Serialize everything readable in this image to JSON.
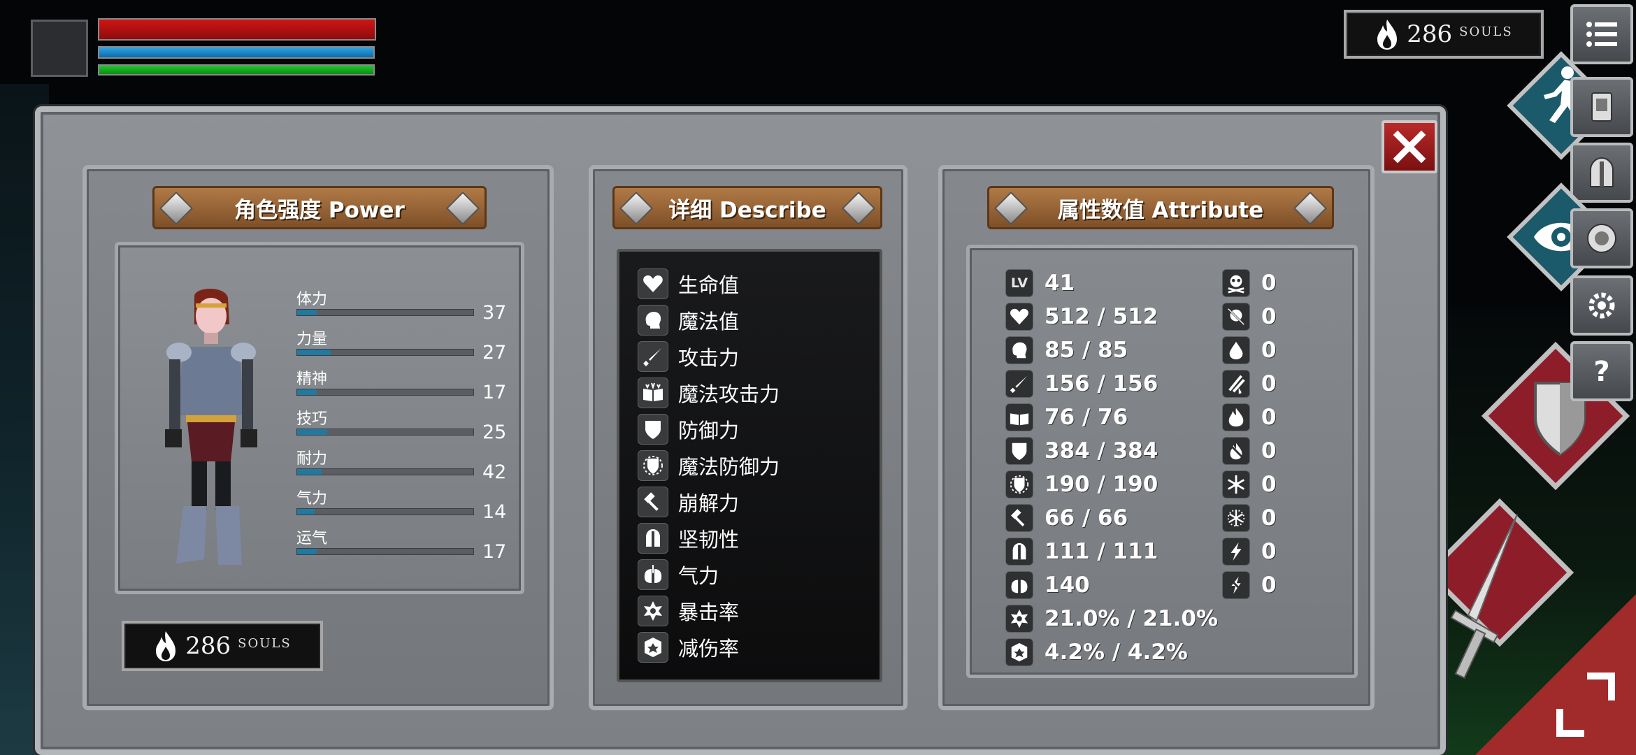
{
  "hud": {
    "souls_top": {
      "value": "286",
      "unit": "SOULS"
    },
    "hp_fill": 1.0,
    "mp_fill": 1.0,
    "stamina_fill": 1.0
  },
  "side_menu": [
    "menu-icon",
    "map-scroll-icon",
    "helmet-icon",
    "rune-icon",
    "gear-icon",
    "help-icon"
  ],
  "power_panel": {
    "title": "角色强度 Power",
    "stats": [
      {
        "label": "体力",
        "value": "37",
        "fill": 0.11
      },
      {
        "label": "力量",
        "value": "27",
        "fill": 0.19
      },
      {
        "label": "精神",
        "value": "17",
        "fill": 0.11
      },
      {
        "label": "技巧",
        "value": "25",
        "fill": 0.17
      },
      {
        "label": "耐力",
        "value": "42",
        "fill": 0.14
      },
      {
        "label": "气力",
        "value": "14",
        "fill": 0.1
      },
      {
        "label": "运气",
        "value": "17",
        "fill": 0.11
      }
    ],
    "souls": {
      "value": "286",
      "unit": "SOULS"
    }
  },
  "describe_panel": {
    "title": "详细 Describe",
    "items": [
      "生命值",
      "魔法值",
      "攻击力",
      "魔法攻击力",
      "防御力",
      "魔法防御力",
      "崩解力",
      "坚韧性",
      "气力",
      "暴击率",
      "减伤率"
    ]
  },
  "attribute_panel": {
    "title": "属性数值 Attribute",
    "lv_label": "LV",
    "left_values": [
      "41",
      "512 / 512",
      "85 / 85",
      "156 / 156",
      "76 / 76",
      "384 / 384",
      "190 / 190",
      "66 / 66",
      "111 / 111",
      "140",
      "21.0% / 21.0%",
      "4.2% / 4.2%"
    ],
    "right_values": [
      "0",
      "0",
      "0",
      "0",
      "0",
      "0",
      "0",
      "0",
      "0",
      "0"
    ]
  }
}
